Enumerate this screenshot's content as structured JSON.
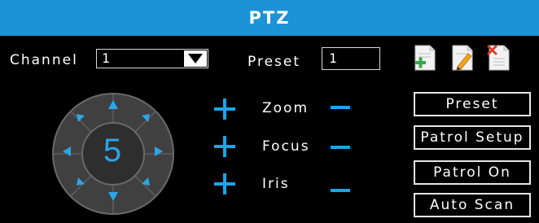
{
  "window": {
    "title": "PTZ"
  },
  "channel": {
    "label": "Channel",
    "value": "1"
  },
  "preset_field": {
    "label": "Preset",
    "value": "1"
  },
  "toolbar": {
    "icons": [
      "add-preset-icon",
      "edit-preset-icon",
      "delete-preset-icon"
    ]
  },
  "dpad": {
    "speed": "5"
  },
  "controls": {
    "zoom": "Zoom",
    "focus": "Focus",
    "iris": "Iris"
  },
  "buttons": {
    "preset": "Preset",
    "patrol_setup": "Patrol Setup",
    "patrol_on": "Patrol On",
    "auto_scan": "Auto Scan"
  },
  "colors": {
    "title_bar": "#1b93d6",
    "accent": "#1ea3e8",
    "background": "#000000"
  }
}
